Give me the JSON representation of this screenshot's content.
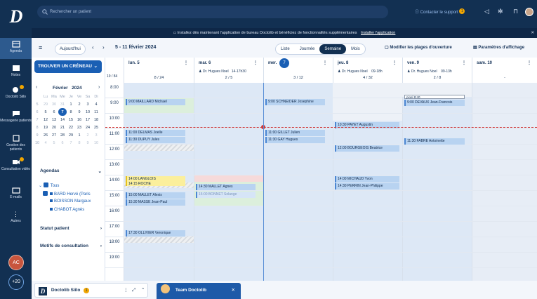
{
  "app": {
    "logo": "D"
  },
  "sidebar": [
    {
      "label": "Agenda",
      "icon": "calendar-icon",
      "active": true
    },
    {
      "label": "Notes",
      "icon": "note-icon"
    },
    {
      "label": "Doctolib Siilo",
      "icon": "chat-icon",
      "badge": "1"
    },
    {
      "label": "Messagerie patients",
      "icon": "message-icon"
    },
    {
      "label": "Gestion des patients",
      "icon": "folder-icon"
    },
    {
      "label": "Consultation vidéo",
      "icon": "video-icon",
      "badge": "1"
    },
    {
      "label": "E-mails",
      "icon": "mail-icon"
    },
    {
      "label": "Autres",
      "icon": "more-icon"
    }
  ],
  "avatar": "AC",
  "more_count": "+20",
  "top": {
    "search_placeholder": "Rechercher un patient",
    "support": "Contacter le support",
    "support_badge": "1"
  },
  "banner": {
    "text": "Installez dès maintenant l'application de bureau Doctolib et bénéficiez de fonctionnalités supplémentaires",
    "link": "Installer l'application"
  },
  "toolbar": {
    "today": "Aujourd'hui",
    "range": "5 - 11 février 2024",
    "views": [
      "Liste",
      "Journée",
      "Semaine",
      "Mois"
    ],
    "active_view": "Semaine",
    "modify": "Modifier les plages d'ouverture",
    "settings": "Paramètres d'affichage"
  },
  "left": {
    "cta": "TROUVER UN CRÉNEAU",
    "month": "Février",
    "year": "2024",
    "weekdays": [
      "Lu",
      "Ma",
      "Me",
      "Je",
      "Ve",
      "Sa",
      "Di"
    ],
    "weeks": [
      [
        "5",
        "29",
        "30",
        "31",
        "1",
        "2",
        "3",
        "4"
      ],
      [
        "6",
        "5",
        "6",
        "7",
        "8",
        "9",
        "10",
        "11"
      ],
      [
        "7",
        "12",
        "13",
        "14",
        "15",
        "16",
        "17",
        "18"
      ],
      [
        "8",
        "19",
        "20",
        "21",
        "22",
        "23",
        "24",
        "25"
      ],
      [
        "9",
        "26",
        "27",
        "28",
        "29",
        "1",
        "2",
        "3"
      ],
      [
        "10",
        "4",
        "5",
        "6",
        "7",
        "8",
        "9",
        "10"
      ]
    ],
    "agendas_title": "Agendas",
    "all": "Tous",
    "agendas": [
      "BARD Hervé (Paris",
      "BOISSON Margaux",
      "CHABOT Agnès"
    ],
    "statut": "Statut patient",
    "motifs": "Motifs de consultation"
  },
  "week": "19 / 84",
  "days": [
    {
      "name": "lun. 5",
      "doctor": "",
      "hours": "",
      "count": "8 / 24"
    },
    {
      "name": "mar. 6",
      "doctor": "Dr. Hugues Noel",
      "hours": "14-17h30",
      "count": "2 / 5"
    },
    {
      "name": "mer.",
      "num": "7",
      "doctor": "",
      "hours": "",
      "count": "3 / 12"
    },
    {
      "name": "jeu. 8",
      "doctor": "Dr. Hugues Noel",
      "hours": "09-18h",
      "count": "4 / 32"
    },
    {
      "name": "ven. 9",
      "doctor": "Dr. Hugues Noel",
      "hours": "09-13h",
      "count": "2 / 8"
    },
    {
      "name": "sam. 10",
      "doctor": "",
      "hours": "",
      "count": "-"
    }
  ],
  "hours": [
    "8:00",
    "9:00",
    "10:00",
    "11:00",
    "12:00",
    "13:00",
    "14:00",
    "15:00",
    "16:00",
    "17:00",
    "18:00",
    "19:00"
  ],
  "appointments": [
    {
      "day": 0,
      "text": "9:00 MAILLARD Michael"
    },
    {
      "day": 0,
      "text": "11:00 DELMAS Joelle"
    },
    {
      "day": 0,
      "text": "11:30 DUPUY Jules"
    },
    {
      "day": 0,
      "text": "14:00 LANGLOIS"
    },
    {
      "day": 0,
      "text": "14:15 ROCHE"
    },
    {
      "day": 0,
      "text": "15:00 MALLET Alexis"
    },
    {
      "day": 0,
      "text": "15:30 MASSE Jean-Paul"
    },
    {
      "day": 0,
      "text": "17:30 OLLIVIER Veronique"
    },
    {
      "day": 1,
      "text": "14:30 MALLET Agnes"
    },
    {
      "day": 1,
      "text": "15:00 BONNET Solange"
    },
    {
      "day": 2,
      "text": "9:00 SCHNEIDER Josephine"
    },
    {
      "day": 2,
      "text": "11:00 GILLET Julien"
    },
    {
      "day": 2,
      "text": "11:30 GAY Hugues"
    },
    {
      "day": 3,
      "text": "10:30 PAYET Augustin"
    },
    {
      "day": 3,
      "text": "12:00 BOURGEOIS Beatrice"
    },
    {
      "day": 3,
      "text": "14:00 MICHAUD Yvon"
    },
    {
      "day": 3,
      "text": "14:30 PERRIN Jean-Philippe"
    },
    {
      "day": 4,
      "text": "9:00 DEVAUX Jean-Francois"
    },
    {
      "day": 4,
      "text": "11:30 FABRE Antoinette"
    }
  ],
  "note": "pioel 8:40",
  "bottom": {
    "chat": "Doctolib Siilo",
    "chat_badge": "1",
    "team": "Team Doctolib"
  }
}
